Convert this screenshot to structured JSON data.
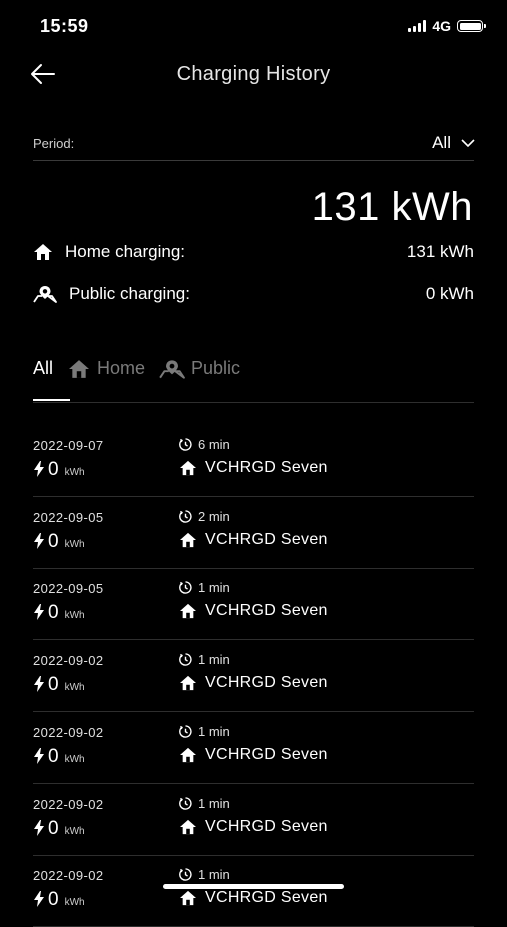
{
  "status_bar": {
    "time": "15:59",
    "network": "4G"
  },
  "header": {
    "title": "Charging History"
  },
  "period": {
    "label": "Period:",
    "value": "All"
  },
  "summary": {
    "total": "131 kWh",
    "home_label": "Home charging:",
    "home_value": "131 kWh",
    "public_label": "Public charging:",
    "public_value": "0 kWh"
  },
  "tabs": [
    {
      "label": "All",
      "active": true
    },
    {
      "label": "Home",
      "active": false
    },
    {
      "label": "Public",
      "active": false
    }
  ],
  "sessions": [
    {
      "date": "2022-09-07",
      "energy": "0",
      "unit": "kWh",
      "duration": "6 min",
      "charger": "VCHRGD Seven"
    },
    {
      "date": "2022-09-05",
      "energy": "0",
      "unit": "kWh",
      "duration": "2 min",
      "charger": "VCHRGD Seven"
    },
    {
      "date": "2022-09-05",
      "energy": "0",
      "unit": "kWh",
      "duration": "1 min",
      "charger": "VCHRGD Seven"
    },
    {
      "date": "2022-09-02",
      "energy": "0",
      "unit": "kWh",
      "duration": "1 min",
      "charger": "VCHRGD Seven"
    },
    {
      "date": "2022-09-02",
      "energy": "0",
      "unit": "kWh",
      "duration": "1 min",
      "charger": "VCHRGD Seven"
    },
    {
      "date": "2022-09-02",
      "energy": "0",
      "unit": "kWh",
      "duration": "1 min",
      "charger": "VCHRGD Seven"
    },
    {
      "date": "2022-09-02",
      "energy": "0",
      "unit": "kWh",
      "duration": "1 min",
      "charger": "VCHRGD Seven"
    }
  ]
}
